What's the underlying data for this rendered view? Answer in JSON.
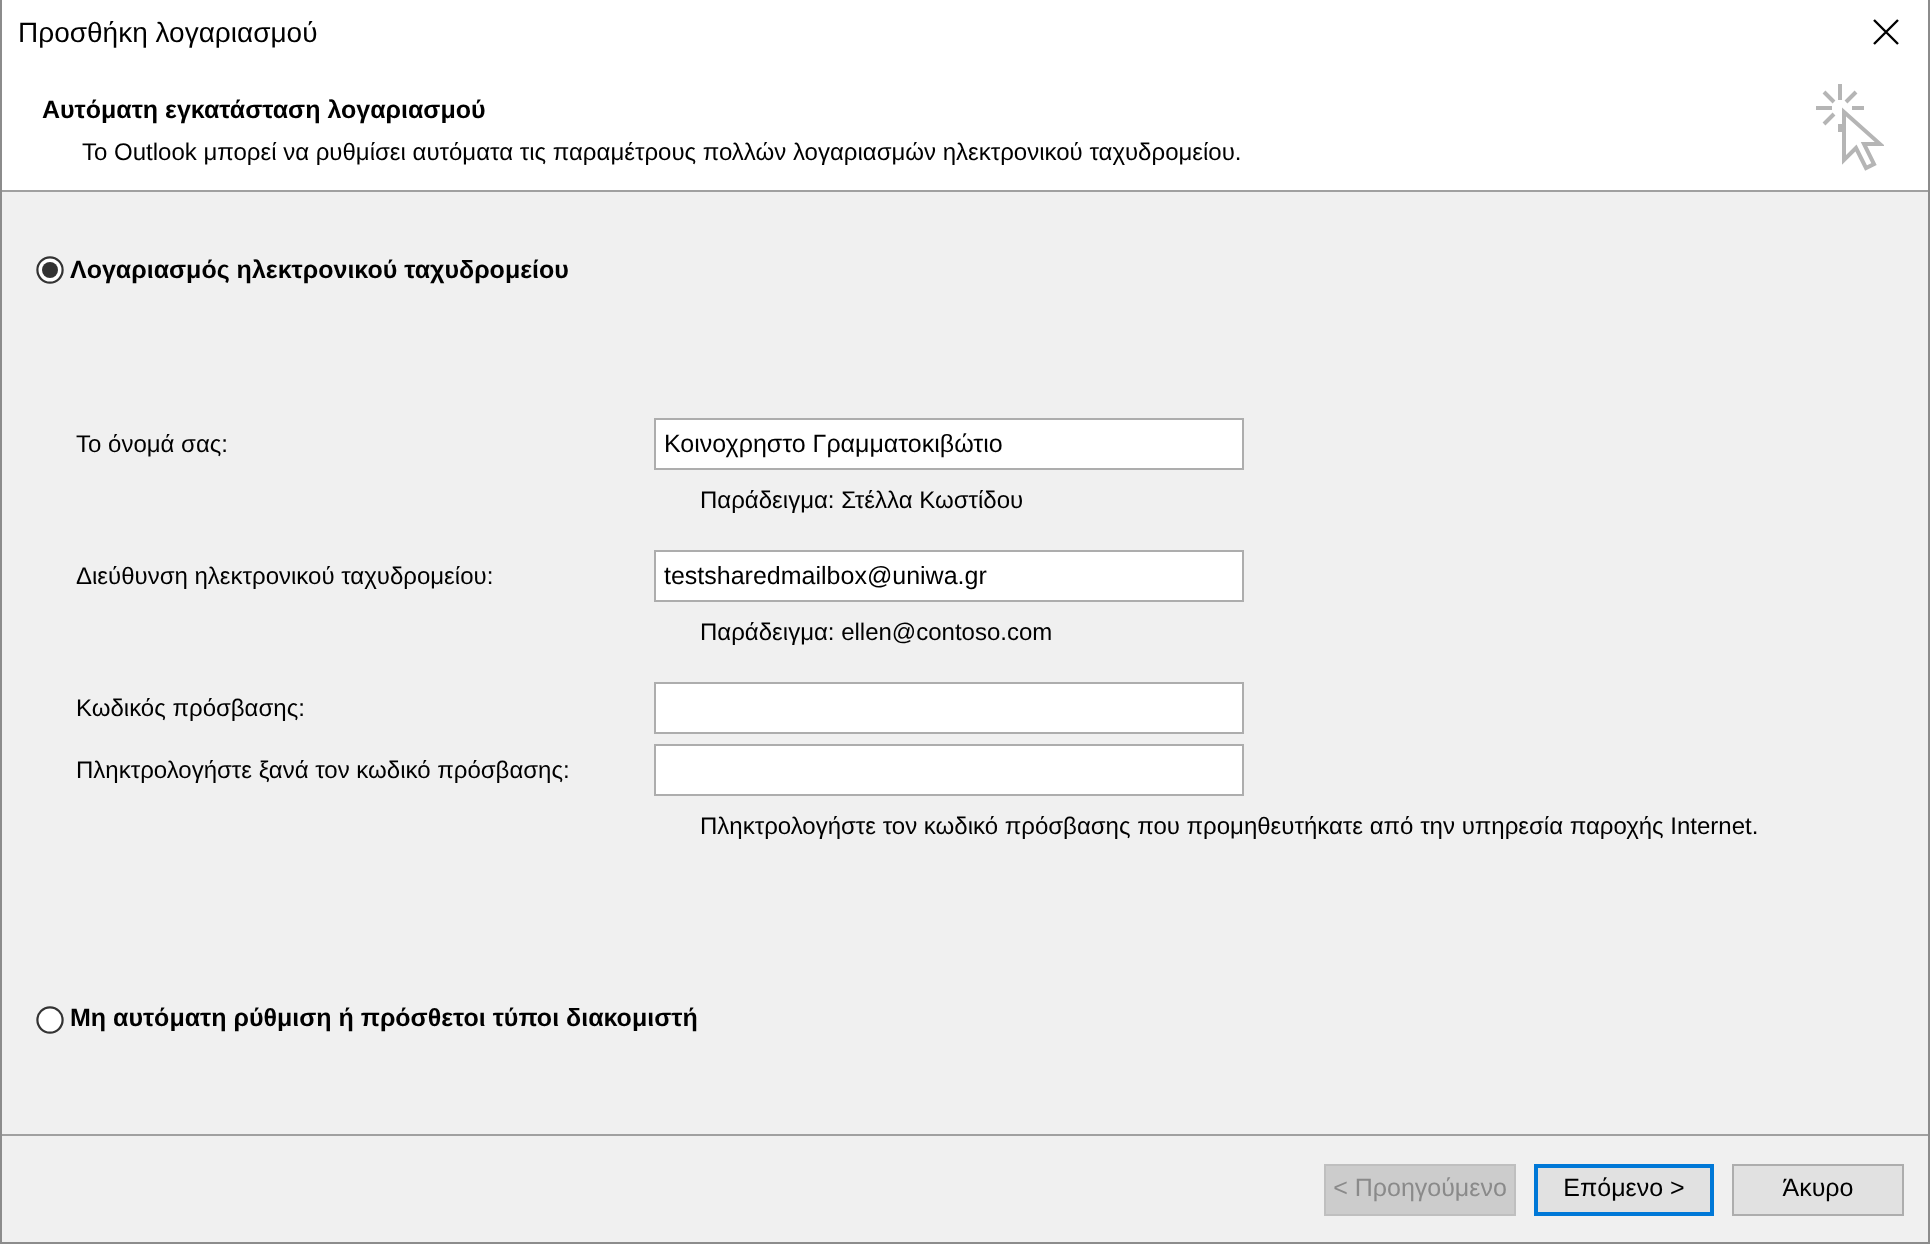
{
  "window": {
    "title": "Προσθήκη λογαριασμού"
  },
  "header": {
    "title": "Αυτόματη εγκατάσταση λογαριασμού",
    "description": "Το Outlook μπορεί να ρυθμίσει αυτόματα τις παραμέτρους πολλών λογαριασμών ηλεκτρονικού ταχυδρομείου."
  },
  "options": [
    {
      "label": "Λογαριασμός ηλεκτρονικού ταχυδρομείου",
      "selected": true
    },
    {
      "label": "Μη αυτόματη ρύθμιση ή πρόσθετοι τύποι διακομιστή",
      "selected": false
    }
  ],
  "fields": [
    {
      "label": "Το όνομά σας:",
      "value": "Κοινοχρηστο Γραμματοκιβώτιο",
      "hint": "Παράδειγμα: Στέλλα Κωστίδου"
    },
    {
      "label": "Διεύθυνση ηλεκτρονικού ταχυδρομείου:",
      "value": "testsharedmailbox@uniwa.gr",
      "hint": "Παράδειγμα: ellen@contoso.com"
    },
    {
      "label": "Κωδικός πρόσβασης:"
    },
    {
      "label": "Πληκτρολογήστε ξανά τον κωδικό πρόσβασης:",
      "hint": "Πληκτρολογήστε τον κωδικό πρόσβασης που προμηθευτήκατε από την υπηρεσία παροχής Internet."
    }
  ],
  "buttons": [
    {
      "label": "< Προηγούμενο",
      "disabled": true,
      "default": false
    },
    {
      "label": "Επόμενο >",
      "disabled": false,
      "default": true
    },
    {
      "label": "Άκυρο",
      "disabled": false,
      "default": false
    }
  ]
}
